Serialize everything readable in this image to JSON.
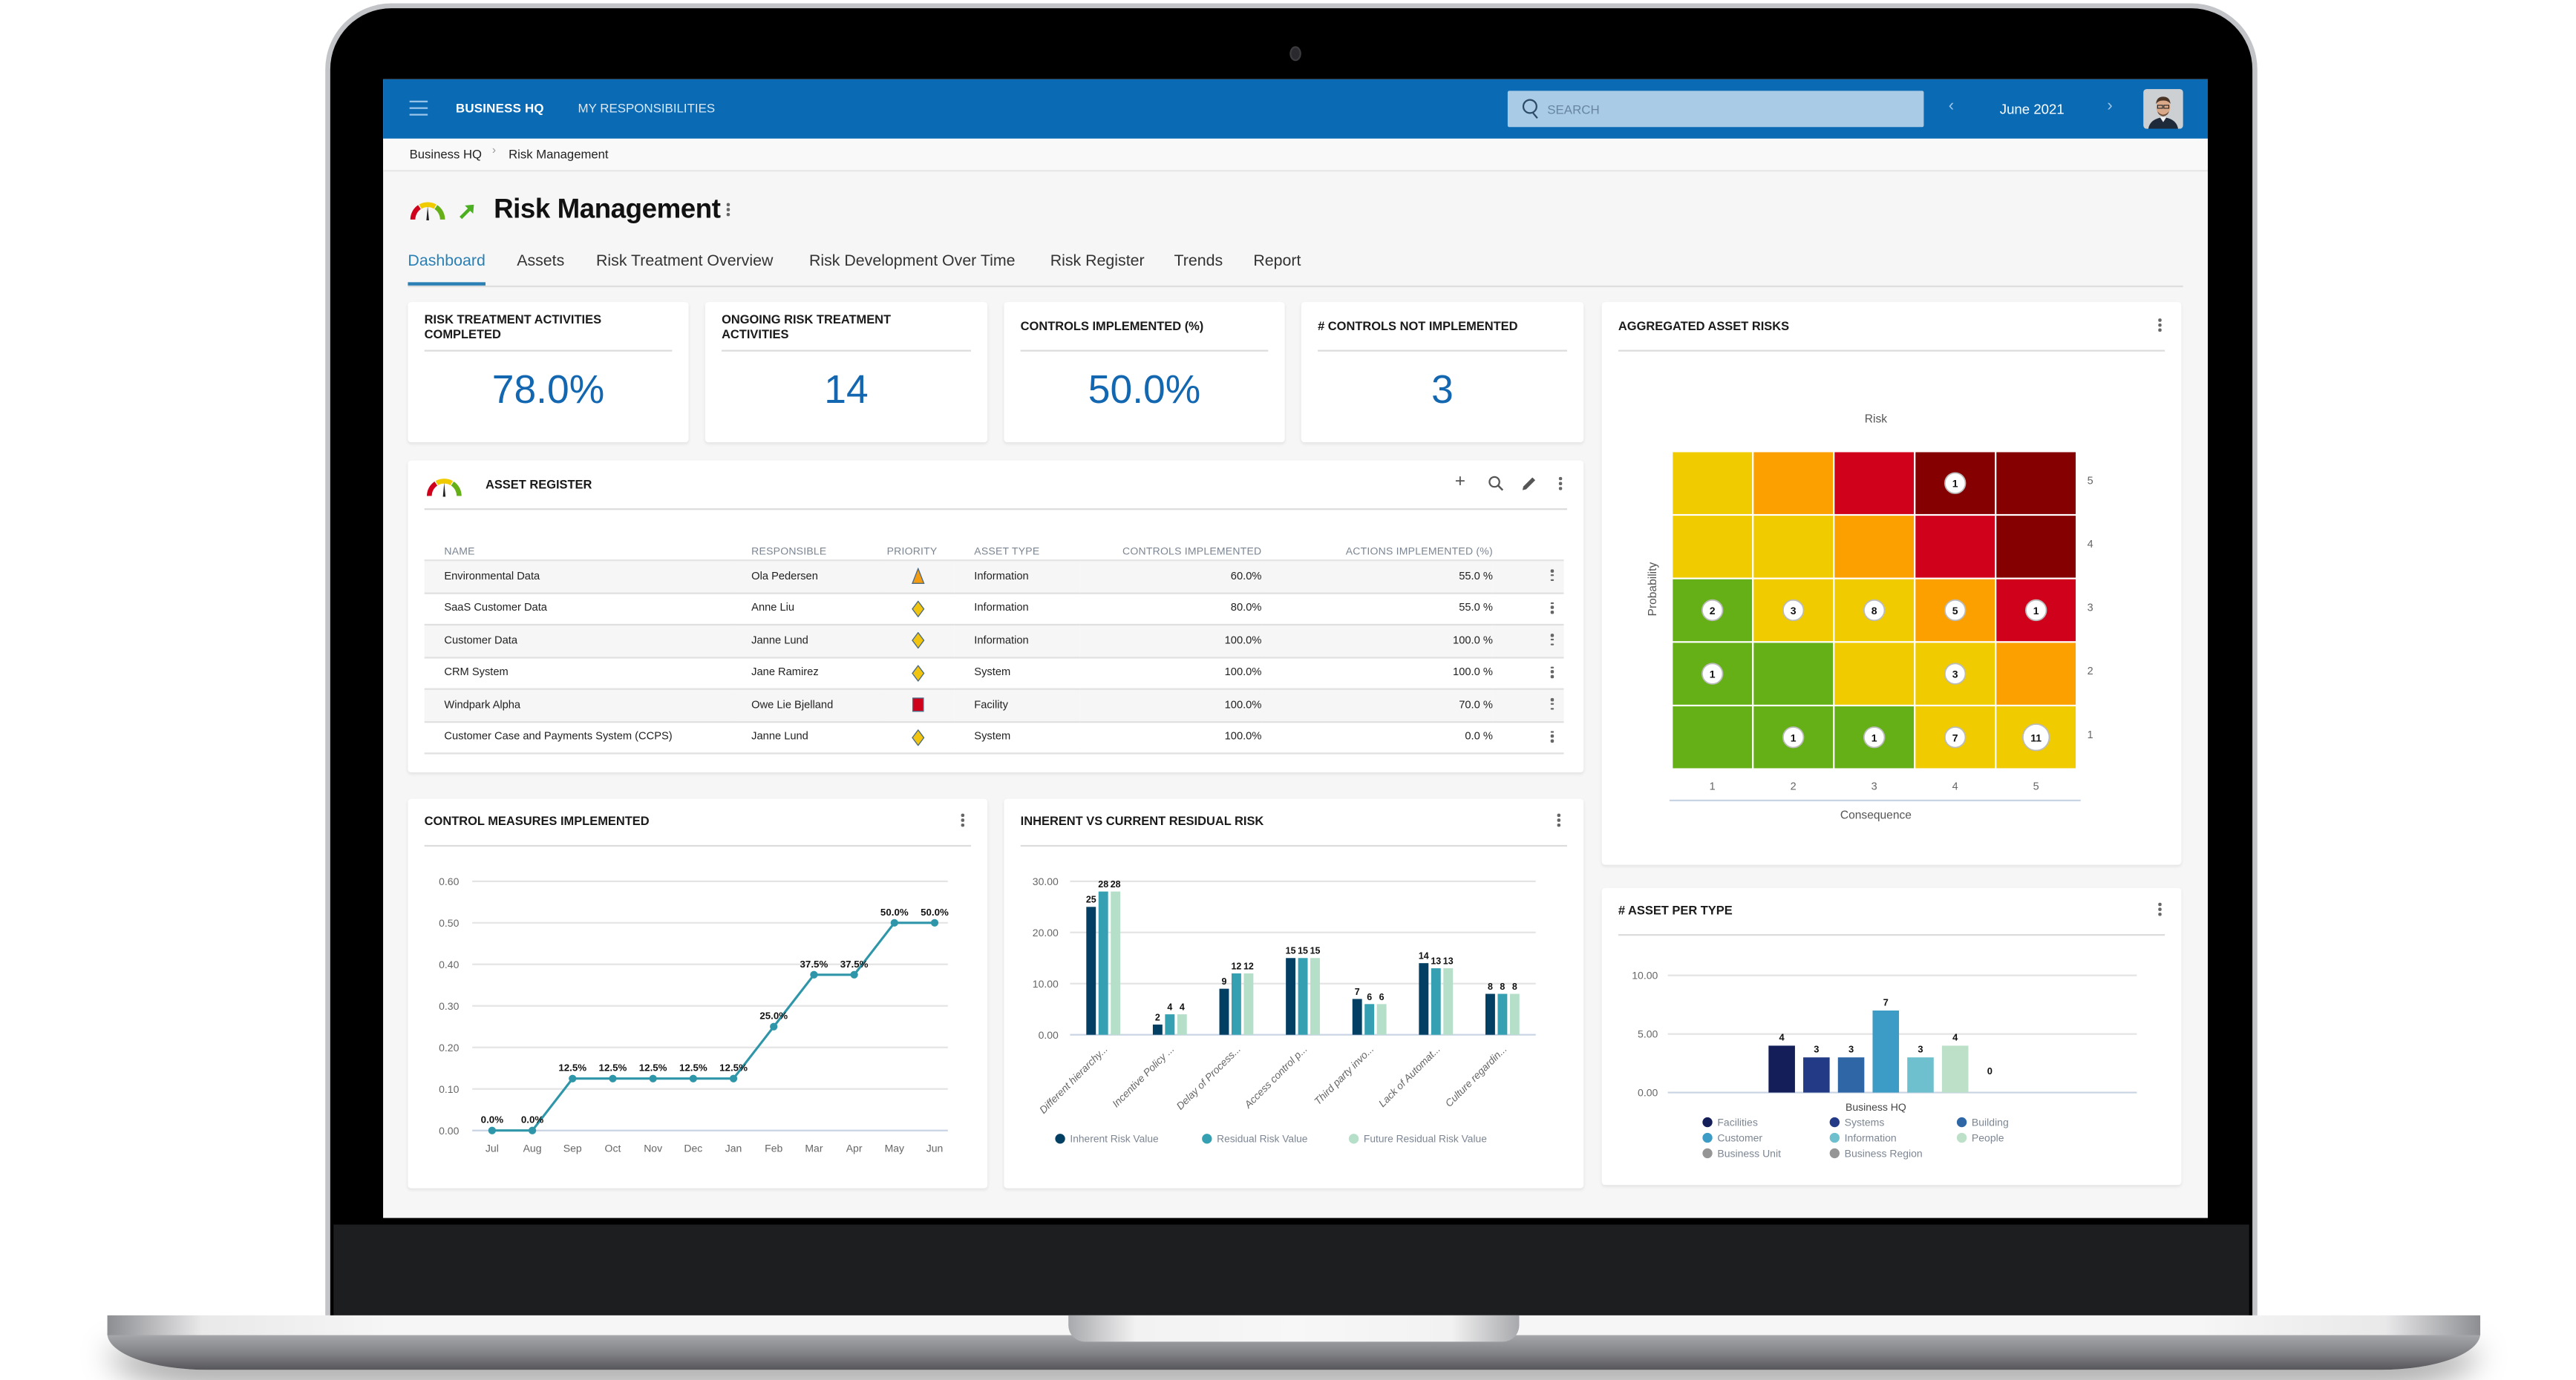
{
  "nav": {
    "menu_icon": "hamburger-menu-icon",
    "home_label": "BUSINESS HQ",
    "responsibilities_label": "MY RESPONSIBILITIES",
    "search_placeholder": "SEARCH",
    "search_icon": "search-icon",
    "period": "June 2021",
    "prev_icon": "chevron-left-icon",
    "next_icon": "chevron-right-icon",
    "avatar": "user-avatar"
  },
  "breadcrumb": {
    "items": [
      "Business HQ",
      "Risk Management"
    ],
    "separator": "›"
  },
  "page": {
    "title": "Risk Management",
    "icons": [
      "risk-gauge-icon",
      "trend-up-arrow-icon",
      "more-vertical-icon"
    ],
    "tabs": [
      {
        "label": "Dashboard",
        "active": true
      },
      {
        "label": "Assets",
        "active": false
      },
      {
        "label": "Risk Treatment Overview",
        "active": false
      },
      {
        "label": "Risk Development Over Time",
        "active": false
      },
      {
        "label": "Risk Register",
        "active": false
      },
      {
        "label": "Trends",
        "active": false
      },
      {
        "label": "Report",
        "active": false
      }
    ]
  },
  "kpis": [
    {
      "title": "RISK TREATMENT ACTIVITIES COMPLETED",
      "value": "78.0%"
    },
    {
      "title": "ONGOING RISK TREATMENT ACTIVITIES",
      "value": "14"
    },
    {
      "title": "CONTROLS IMPLEMENTED (%)",
      "value": "50.0%"
    },
    {
      "title": "# CONTROLS NOT IMPLEMENTED",
      "value": "3"
    }
  ],
  "asset_register": {
    "title": "ASSET REGISTER",
    "actions": [
      "add-icon",
      "search-icon",
      "edit-pencil-icon",
      "more-vertical-icon"
    ],
    "columns": [
      "NAME",
      "RESPONSIBLE",
      "PRIORITY",
      "ASSET TYPE",
      "CONTROLS IMPLEMENTED",
      "ACTIONS IMPLEMENTED (%)"
    ],
    "rows": [
      {
        "name": "Environmental Data",
        "responsible": "Ola Pedersen",
        "priority": "medium-triangle",
        "asset_type": "Information",
        "controls": "60.0%",
        "actions": "55.0 %"
      },
      {
        "name": "SaaS Customer Data",
        "responsible": "Anne Liu",
        "priority": "low-diamond",
        "asset_type": "Information",
        "controls": "80.0%",
        "actions": "55.0 %"
      },
      {
        "name": "Customer Data",
        "responsible": "Janne Lund",
        "priority": "low-diamond",
        "asset_type": "Information",
        "controls": "100.0%",
        "actions": "100.0 %"
      },
      {
        "name": "CRM System",
        "responsible": "Jane Ramirez",
        "priority": "low-diamond",
        "asset_type": "System",
        "controls": "100.0%",
        "actions": "100.0 %"
      },
      {
        "name": "Windpark Alpha",
        "responsible": "Owe Lie Bjelland",
        "priority": "high-square",
        "asset_type": "Facility",
        "controls": "100.0%",
        "actions": "70.0 %"
      },
      {
        "name": "Customer Case and Payments System (CCPS)",
        "responsible": "Janne Lund",
        "priority": "low-diamond",
        "asset_type": "System",
        "controls": "100.0%",
        "actions": "0.0 %"
      }
    ],
    "priority_colors": {
      "medium-triangle": "#f39c12",
      "low-diamond": "#f1c40f",
      "high-square": "#d0021b"
    }
  },
  "chart_data": [
    {
      "id": "aggregated-asset-risks",
      "type": "heatmap",
      "title": "AGGREGATED ASSET RISKS",
      "subtitle": "Risk",
      "xlabel": "Consequence",
      "ylabel": "Probability",
      "x_ticks": [
        "1",
        "2",
        "3",
        "4",
        "5"
      ],
      "y_ticks": [
        "1",
        "2",
        "3",
        "4",
        "5"
      ],
      "palette": {
        "green": "#66b017",
        "yellow": "#f0cb00",
        "orange": "#fca000",
        "red": "#d0021b",
        "darkred": "#850000"
      },
      "cells_by_probability_desc": [
        {
          "probability": 5,
          "colors": [
            "yellow",
            "orange",
            "red",
            "darkred",
            "darkred"
          ],
          "counts": [
            null,
            null,
            null,
            1,
            null
          ]
        },
        {
          "probability": 4,
          "colors": [
            "yellow",
            "yellow",
            "orange",
            "red",
            "darkred"
          ],
          "counts": [
            null,
            null,
            null,
            null,
            null
          ]
        },
        {
          "probability": 3,
          "colors": [
            "green",
            "yellow",
            "yellow",
            "orange",
            "red"
          ],
          "counts": [
            2,
            3,
            8,
            5,
            1
          ]
        },
        {
          "probability": 2,
          "colors": [
            "green",
            "green",
            "yellow",
            "yellow",
            "orange"
          ],
          "counts": [
            1,
            null,
            null,
            3,
            null
          ]
        },
        {
          "probability": 1,
          "colors": [
            "green",
            "green",
            "green",
            "yellow",
            "yellow"
          ],
          "counts": [
            null,
            1,
            1,
            7,
            11
          ]
        }
      ]
    },
    {
      "id": "control-measures-implemented",
      "type": "line",
      "title": "CONTROL MEASURES IMPLEMENTED",
      "x": [
        "Jul",
        "Aug",
        "Sep",
        "Oct",
        "Nov",
        "Dec",
        "Jan",
        "Feb",
        "Mar",
        "Apr",
        "May",
        "Jun"
      ],
      "values": [
        0.0,
        0.0,
        0.125,
        0.125,
        0.125,
        0.125,
        0.125,
        0.25,
        0.375,
        0.375,
        0.5,
        0.5
      ],
      "data_labels": [
        "0.0%",
        "0.0%",
        "12.5%",
        "12.5%",
        "12.5%",
        "12.5%",
        "12.5%",
        "25.0%",
        "37.5%",
        "37.5%",
        "50.0%",
        "50.0%"
      ],
      "y_ticks": [
        "0.00",
        "0.10",
        "0.20",
        "0.30",
        "0.40",
        "0.50",
        "0.60"
      ],
      "ylim": [
        0,
        0.6
      ],
      "color": "#2e96a8",
      "grid": true
    },
    {
      "id": "inherent-vs-residual-risk",
      "type": "bar",
      "title": "INHERENT VS CURRENT RESIDUAL RISK",
      "categories": [
        "Different hierarchy...",
        "Incentive Policy ...",
        "Delay of Process...",
        "Access control p...",
        "Third party invo...",
        "Lack of Automat...",
        "Culture regardin..."
      ],
      "series": [
        {
          "name": "Inherent Risk Value",
          "color": "#033f63",
          "values": [
            25,
            2,
            9,
            15,
            7,
            14,
            8
          ]
        },
        {
          "name": "Residual Risk Value",
          "color": "#35a0b2",
          "values": [
            28,
            4,
            12,
            15,
            6,
            13,
            8
          ]
        },
        {
          "name": "Future Residual Risk Value",
          "color": "#b5dfc9",
          "values": [
            28,
            4,
            12,
            15,
            6,
            13,
            8
          ]
        }
      ],
      "y_ticks": [
        "0.00",
        "10.00",
        "20.00",
        "30.00"
      ],
      "ylim": [
        0,
        30
      ],
      "legend": "bottom",
      "grid": true
    },
    {
      "id": "asset-per-type",
      "type": "bar",
      "title": "# ASSET PER TYPE",
      "categories": [
        "Business HQ"
      ],
      "series": [
        {
          "name": "Facilities",
          "color": "#141f5a",
          "values": [
            4
          ]
        },
        {
          "name": "Systems",
          "color": "#233a86",
          "values": [
            3
          ]
        },
        {
          "name": "Building",
          "color": "#2f67a6",
          "values": [
            3
          ]
        },
        {
          "name": "Customer",
          "color": "#3d9cc6",
          "values": [
            7
          ]
        },
        {
          "name": "Information",
          "color": "#6ec0ce",
          "values": [
            3
          ]
        },
        {
          "name": "People",
          "color": "#bde0c8",
          "values": [
            4
          ]
        },
        {
          "name": "Business Unit",
          "color": "#959595",
          "values": [
            0
          ]
        },
        {
          "name": "Business Region",
          "color": "#959595",
          "values": [
            null
          ]
        }
      ],
      "visible_labels": [
        "4",
        "3",
        "3",
        "7",
        "3",
        "4",
        "0"
      ],
      "y_ticks": [
        "0.00",
        "5.00",
        "10.00"
      ],
      "ylim": [
        0,
        10
      ],
      "legend": "bottom",
      "grid": true
    }
  ]
}
